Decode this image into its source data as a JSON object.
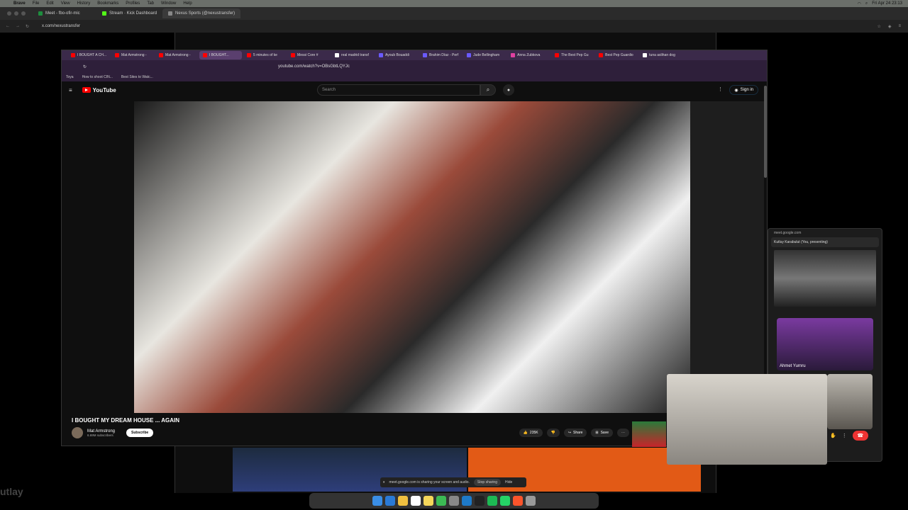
{
  "menubar": {
    "items": [
      "Brave",
      "File",
      "Edit",
      "View",
      "History",
      "Bookmarks",
      "Profiles",
      "Tab",
      "Window",
      "Help"
    ],
    "clock": "Fri Apr 24 23:13"
  },
  "outer_tabs": [
    {
      "label": "Meet - fbo-ofir-mic",
      "color": "#1e8e3e"
    },
    {
      "label": "Stream · Kick Dashboard",
      "color": "#53fc18"
    },
    {
      "label": "Nexus Sports (@nexustransfer)",
      "color": "#888888"
    }
  ],
  "outer_url": "x.com/nexustransfer",
  "inner_tabs": [
    {
      "label": "I BOUGHT A CH...",
      "color": "#ff0000"
    },
    {
      "label": "Mat Armstrong -",
      "color": "#ff0000"
    },
    {
      "label": "Mat Armstrong -",
      "color": "#ff0000"
    },
    {
      "label": "I BOUGHT...",
      "color": "#ff0000"
    },
    {
      "label": "5 minutes of ke",
      "color": "#ff0000"
    },
    {
      "label": "Messi Core #",
      "color": "#ff0000"
    },
    {
      "label": "real madrid transf",
      "color": "#ffffff"
    },
    {
      "label": "Ayoub Bouaddi",
      "color": "#6a5aff"
    },
    {
      "label": "Brahim Díaz - Perf",
      "color": "#6a5aff"
    },
    {
      "label": "Jude Bellingham",
      "color": "#6a5aff"
    },
    {
      "label": "Anna Zubkova",
      "color": "#e040a0"
    },
    {
      "label": "The Best Pep Gu",
      "color": "#ff0000"
    },
    {
      "label": "Best Pep Guardio",
      "color": "#ff0000"
    },
    {
      "label": "tuna aslihan dog",
      "color": "#ffffff"
    }
  ],
  "inner_url": "youtube.com/watch?v=OBsGbtLQYJc",
  "bookmarks": [
    "Toya",
    "How to shoot CIN...",
    "Best Sites to Watc..."
  ],
  "youtube": {
    "logo": "YouTube",
    "search_placeholder": "Search",
    "signin": "Sign in",
    "video_title": "I BOUGHT MY DREAM HOUSE ... AGAIN",
    "channel_name": "Mat Armstrong",
    "subscribers": "6.69M subscribers",
    "subscribe": "Subscribe",
    "likes": "235K",
    "share": "Share",
    "save": "Save"
  },
  "meet": {
    "header": "meet.google.com",
    "presenting": "Kutluy Karabulut (You, presenting)",
    "participant": "Ahmet Yurnru"
  },
  "share_bar": {
    "message": "meet.google.com is sharing your screen and audio.",
    "stop": "Stop sharing",
    "hide": "Hide"
  }
}
